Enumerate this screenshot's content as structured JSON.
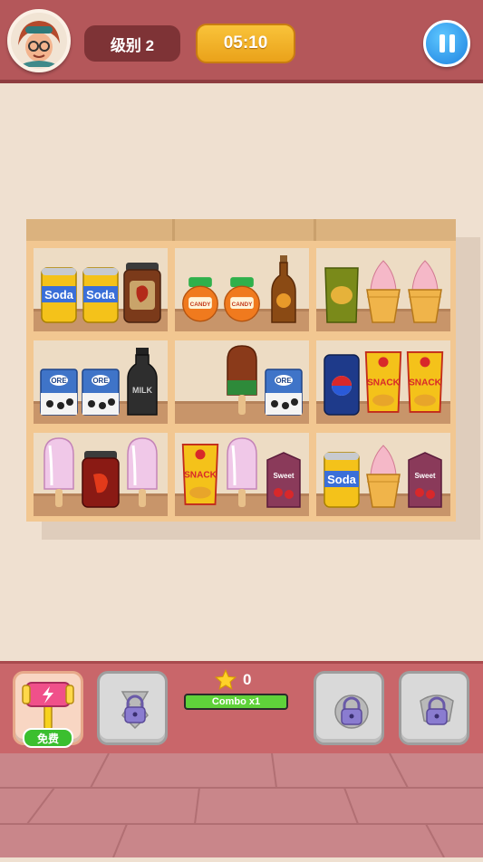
{
  "header": {
    "level_label": "级别 2",
    "timer": "05:10"
  },
  "icons": {
    "avatar": "player-avatar-icon",
    "pause": "pause-icon",
    "star": "star-icon",
    "hammer": "hammer-icon",
    "lock": "lock-icon"
  },
  "colors": {
    "topbar": "#b4575a",
    "timer": "#f4b42a",
    "pause": "#1e82e0",
    "combo_fill": "#5fd13a",
    "free_badge": "#3bbf2f"
  },
  "shelf": {
    "cells": [
      {
        "items": [
          {
            "type": "soda-can",
            "label": "Soda"
          },
          {
            "type": "soda-can",
            "label": "Soda"
          },
          {
            "type": "sauce-jar",
            "label": ""
          }
        ]
      },
      {
        "items": [
          {
            "type": "candy-jar",
            "label": "CANDY"
          },
          {
            "type": "candy-jar",
            "label": "CANDY"
          },
          {
            "type": "brown-bottle",
            "label": ""
          }
        ]
      },
      {
        "items": [
          {
            "type": "chips-green",
            "label": ""
          },
          {
            "type": "ice-cream-cone",
            "label": ""
          },
          {
            "type": "ice-cream-cone",
            "label": ""
          }
        ]
      },
      {
        "items": [
          {
            "type": "oreo-box",
            "label": "ORE"
          },
          {
            "type": "oreo-box",
            "label": "ORE"
          },
          {
            "type": "milk-bottle",
            "label": "MILK"
          }
        ]
      },
      {
        "items": [
          {
            "type": "empty",
            "label": ""
          },
          {
            "type": "popsicle-choc",
            "label": ""
          },
          {
            "type": "oreo-box",
            "label": "ORE"
          }
        ]
      },
      {
        "items": [
          {
            "type": "pepsi-can",
            "label": ""
          },
          {
            "type": "snack-bag",
            "label": "SNACK"
          },
          {
            "type": "snack-bag",
            "label": "SNACK"
          }
        ]
      },
      {
        "items": [
          {
            "type": "popsicle-pink",
            "label": ""
          },
          {
            "type": "chili-jar",
            "label": ""
          },
          {
            "type": "popsicle-pink",
            "label": ""
          }
        ]
      },
      {
        "items": [
          {
            "type": "snack-bag",
            "label": "SNACK"
          },
          {
            "type": "popsicle-pink",
            "label": ""
          },
          {
            "type": "juice-box",
            "label": "Sweet"
          }
        ]
      },
      {
        "items": [
          {
            "type": "soda-can",
            "label": "Soda"
          },
          {
            "type": "ice-cream-cone",
            "label": ""
          },
          {
            "type": "juice-box",
            "label": "Sweet"
          }
        ]
      }
    ]
  },
  "bottom": {
    "score": "0",
    "combo_label": "Combo x1",
    "combo_progress": 1.0,
    "free_label": "免费",
    "tools": [
      {
        "name": "hammer",
        "locked": false
      },
      {
        "name": "tool-2",
        "locked": true
      },
      {
        "name": "tool-3",
        "locked": true
      },
      {
        "name": "tool-4",
        "locked": true
      }
    ]
  }
}
